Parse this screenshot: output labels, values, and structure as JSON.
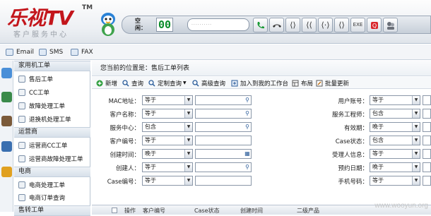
{
  "header": {
    "logo": "乐视TV",
    "logo_tm": "TM",
    "logo_sub": "客户服务中心",
    "status_label": "空闲：",
    "status_counter": "00"
  },
  "toolbar_icons": [
    "answer-icon",
    "hangup-icon",
    "hold-icon",
    "transfer-icon",
    "consult-icon",
    "conference-icon",
    "ivr-icon",
    "mute-icon",
    "setting-icon"
  ],
  "menubar": {
    "email": "Email",
    "sms": "SMS",
    "fax": "FAX"
  },
  "sidebar": {
    "sections": [
      {
        "title": "家用机工单",
        "items": [
          "售后工单",
          "CC工单",
          "故障处理工单",
          "退换机处理工单"
        ]
      },
      {
        "title": "运营商",
        "items": [
          "运营商CC工单",
          "运营商故障处理工单"
        ]
      },
      {
        "title": "电商",
        "items": [
          "电商处理工单",
          "电商订单查询"
        ]
      },
      {
        "title": "售转工单",
        "items": []
      }
    ]
  },
  "main": {
    "breadcrumb": "您当前的位置是：售后工单列表",
    "actions": [
      "新增",
      "查询",
      "定制查询",
      "高级查询",
      "加入到我的工作台",
      "布局",
      "批量更新"
    ],
    "form_left": [
      {
        "label": "MAC地址：",
        "op": "等于",
        "picker": "lookup"
      },
      {
        "label": "客户名称：",
        "op": "等于",
        "picker": "lookup"
      },
      {
        "label": "服务中心：",
        "op": "包含",
        "picker": "lookup"
      },
      {
        "label": "客户编号：",
        "op": "等于",
        "picker": ""
      },
      {
        "label": "创建时间：",
        "op": "晚于",
        "picker": "calendar"
      },
      {
        "label": "创建人：",
        "op": "等于",
        "picker": "lookup"
      },
      {
        "label": "Case编号：",
        "op": "等于",
        "picker": ""
      }
    ],
    "form_right": [
      {
        "label": "用户账号：",
        "op": "等于"
      },
      {
        "label": "服务工程师：",
        "op": "包含"
      },
      {
        "label": "有效期：",
        "op": "晚于"
      },
      {
        "label": "Case状态：",
        "op": "包含"
      },
      {
        "label": "受理人信息：",
        "op": "等于"
      },
      {
        "label": "预约日期：",
        "op": "晚于"
      },
      {
        "label": "手机号码：",
        "op": "等于"
      }
    ],
    "table_headers": [
      "操作",
      "客户编号",
      "Case状态",
      "创建时间",
      "二级产品"
    ]
  },
  "watermark": "www.wooyun.org",
  "colors": {
    "brand_red": "#c3161c",
    "counter_green": "#0a8c2a",
    "accent_blue": "#2a5c9a"
  }
}
